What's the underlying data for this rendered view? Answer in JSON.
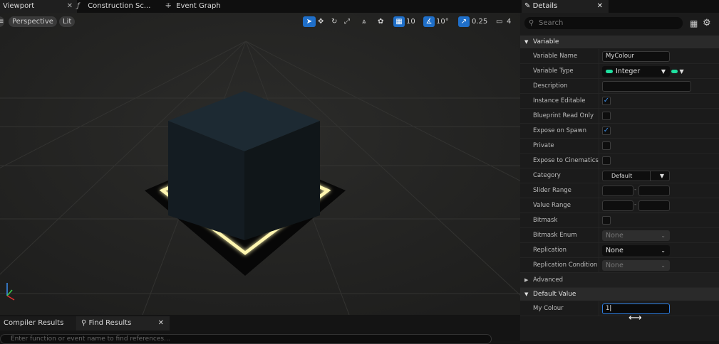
{
  "tabs": {
    "viewport": "Viewport",
    "construction": "Construction Sc...",
    "event_graph": "Event Graph"
  },
  "viewport_toolbar": {
    "perspective": "Perspective",
    "lit": "Lit",
    "grid_snap": "10",
    "rotation_snap": "10°",
    "scale_snap": "0.25",
    "camera_speed": "4"
  },
  "bottom_tabs": {
    "compiler": "Compiler Results",
    "find": "Find Results"
  },
  "find_search": {
    "placeholder": "Enter function or event name to find references..."
  },
  "details": {
    "title": "Details",
    "search_placeholder": "Search",
    "sections": {
      "variable": "Variable",
      "advanced": "Advanced",
      "default_value": "Default Value"
    },
    "rows": {
      "variable_name": {
        "label": "Variable Name",
        "value": "MyColour"
      },
      "variable_type": {
        "label": "Variable Type",
        "value": "Integer"
      },
      "description": {
        "label": "Description",
        "value": ""
      },
      "instance_editable": {
        "label": "Instance Editable",
        "checked": true
      },
      "blueprint_read_only": {
        "label": "Blueprint Read Only",
        "checked": false
      },
      "expose_on_spawn": {
        "label": "Expose on Spawn",
        "checked": true
      },
      "private": {
        "label": "Private",
        "checked": false
      },
      "expose_to_cinematics": {
        "label": "Expose to Cinematics",
        "checked": false
      },
      "category": {
        "label": "Category",
        "value": "Default"
      },
      "slider_range": {
        "label": "Slider Range",
        "min": "",
        "max": ""
      },
      "value_range": {
        "label": "Value Range",
        "min": "",
        "max": ""
      },
      "bitmask": {
        "label": "Bitmask",
        "checked": false
      },
      "bitmask_enum": {
        "label": "Bitmask Enum",
        "value": "None"
      },
      "replication": {
        "label": "Replication",
        "value": "None"
      },
      "replication_condition": {
        "label": "Replication Condition",
        "value": "None"
      },
      "my_colour": {
        "label": "My Colour",
        "value": "1"
      }
    }
  },
  "colors": {
    "accent_blue": "#1f6fc9",
    "integer_pin": "#1fe0a0",
    "glow": "#fff6b0"
  }
}
